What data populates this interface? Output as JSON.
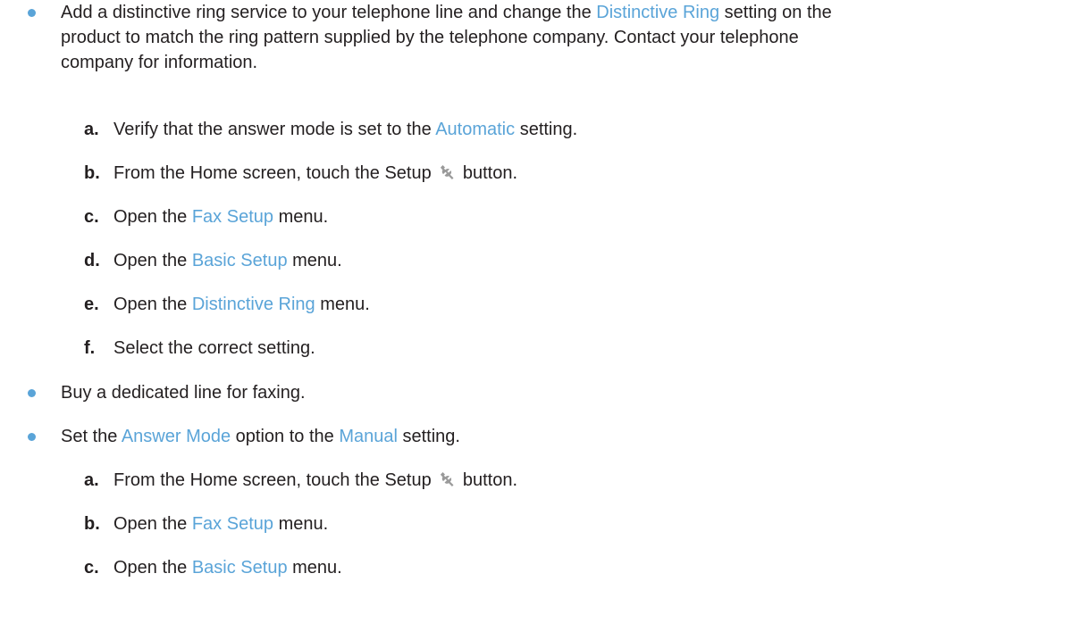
{
  "bullets": [
    {
      "lines": [
        [
          "Add a distinctive ring service to your telephone line and change the ",
          "Distinctive Ring",
          " setting on the"
        ],
        "product to match the ring pattern supplied by the telephone company. Contact your telephone",
        "company for information."
      ],
      "steps": [
        {
          "letter": "a.",
          "pre": "Verify that the answer mode is set to the ",
          "link": "Automatic",
          "post": " setting."
        },
        {
          "letter": "b.",
          "pre": "From the Home screen, touch the Setup ",
          "icon": "wrench-icon",
          "post": " button."
        },
        {
          "letter": "c.",
          "pre": "Open the ",
          "link": "Fax Setup",
          "post": " menu."
        },
        {
          "letter": "d.",
          "pre": "Open the ",
          "link": "Basic Setup",
          "post": " menu."
        },
        {
          "letter": "e.",
          "pre": "Open the ",
          "link": "Distinctive Ring",
          "post": " menu."
        },
        {
          "letter": "f.",
          "pre": "Select the correct setting.",
          "post": ""
        }
      ]
    },
    {
      "text": "Buy a dedicated line for faxing."
    },
    {
      "pre": "Set the ",
      "link1": "Answer Mode",
      "mid": " option to the ",
      "link2": "Manual",
      "post": " setting.",
      "steps": [
        {
          "letter": "a.",
          "pre": "From the Home screen, touch the Setup ",
          "icon": "wrench-icon",
          "post": " button."
        },
        {
          "letter": "b.",
          "pre": "Open the ",
          "link": "Fax Setup",
          "post": " menu."
        },
        {
          "letter": "c.",
          "pre": "Open the ",
          "link": "Basic Setup",
          "post": " menu."
        }
      ]
    }
  ],
  "colors": {
    "accent": "#5aa4d8",
    "text": "#231f20",
    "icon": "#9a9a9a"
  }
}
